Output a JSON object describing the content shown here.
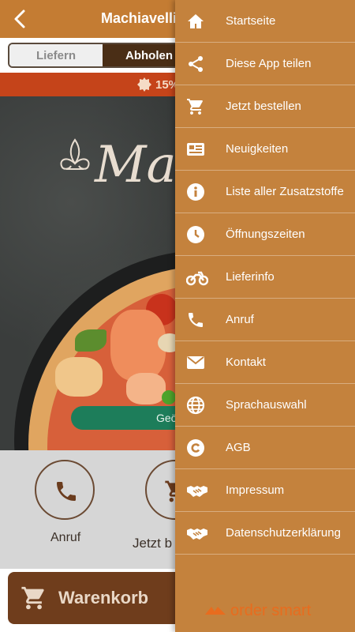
{
  "header": {
    "title": "Machiavelli a"
  },
  "order_mode": {
    "options": [
      "Liefern",
      "Abholen"
    ],
    "selected": "Abholen"
  },
  "promo": {
    "text": "15%"
  },
  "hero": {
    "logo_text": "Ma",
    "status_pill": "Geö"
  },
  "actions": [
    {
      "label": "Anruf",
      "icon": "phone-icon"
    },
    {
      "label": "Jetzt b",
      "icon": "cart-icon"
    }
  ],
  "cart": {
    "label": "Warenkorb"
  },
  "drawer": {
    "items": [
      {
        "label": "Startseite",
        "icon": "home-icon"
      },
      {
        "label": "Diese App teilen",
        "icon": "share-icon"
      },
      {
        "label": "Jetzt bestellen",
        "icon": "cart-icon"
      },
      {
        "label": "Neuigkeiten",
        "icon": "news-icon"
      },
      {
        "label": "Liste aller Zusatzstoffe",
        "icon": "info-icon"
      },
      {
        "label": "Öffnungszeiten",
        "icon": "clock-icon"
      },
      {
        "label": "Lieferinfo",
        "icon": "motorcycle-icon"
      },
      {
        "label": "Anruf",
        "icon": "phone-icon"
      },
      {
        "label": "Kontakt",
        "icon": "envelope-icon"
      },
      {
        "label": "Sprachauswahl",
        "icon": "globe-icon"
      },
      {
        "label": "AGB",
        "icon": "copyright-icon"
      },
      {
        "label": "Impressum",
        "icon": "handshake-icon"
      },
      {
        "label": "Datenschutzerklärung",
        "icon": "handshake-icon"
      }
    ],
    "brand": "order smart"
  },
  "colors": {
    "primary": "#c4823d",
    "topbar": "#c47c33",
    "promo": "#c5441a",
    "cart": "#6f3d1c",
    "brand": "#e86c1e"
  }
}
